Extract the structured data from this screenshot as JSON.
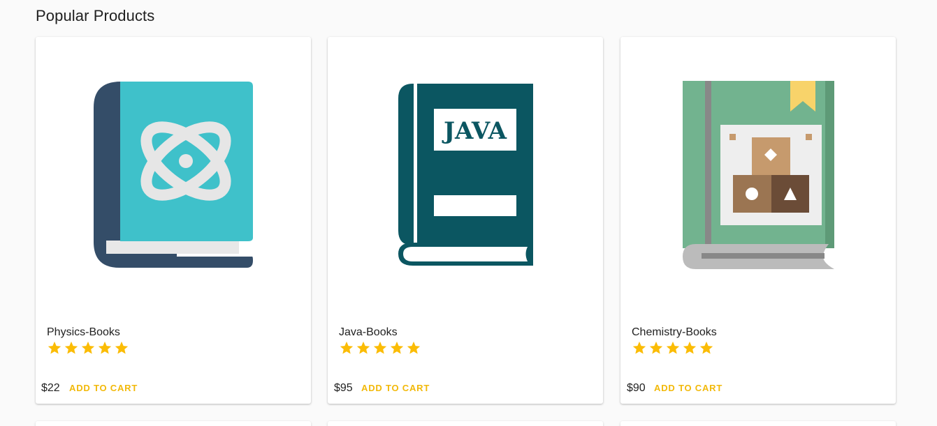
{
  "section": {
    "title": "Popular Products"
  },
  "products": [
    {
      "name": "Physics-Books",
      "price": "$22",
      "rating": 5,
      "rating_max": 5,
      "action_label": "ADD TO CART",
      "image_icon": "physics-book-icon",
      "colors": {
        "spine": "#344d68",
        "cover": "#3fc1ca",
        "pages": "#e8e8e8",
        "emblem": "#e6e6e6"
      }
    },
    {
      "name": "Java-Books",
      "price": "$95",
      "rating": 5,
      "rating_max": 5,
      "action_label": "ADD TO CART",
      "image_icon": "java-book-icon",
      "cover_text": "JAVA",
      "colors": {
        "cover": "#0b5661",
        "label": "#ffffff"
      }
    },
    {
      "name": "Chemistry-Books",
      "price": "$90",
      "rating": 5,
      "rating_max": 5,
      "action_label": "ADD TO CART",
      "image_icon": "chemistry-book-icon",
      "colors": {
        "cover": "#72b38f",
        "spine": "#888888",
        "bookmark": "#f8d36a",
        "pages": "#bbbbbb"
      }
    }
  ],
  "theme": {
    "accent": "#f2b90a",
    "star": "#fbbc05",
    "background": "#fafafa"
  }
}
